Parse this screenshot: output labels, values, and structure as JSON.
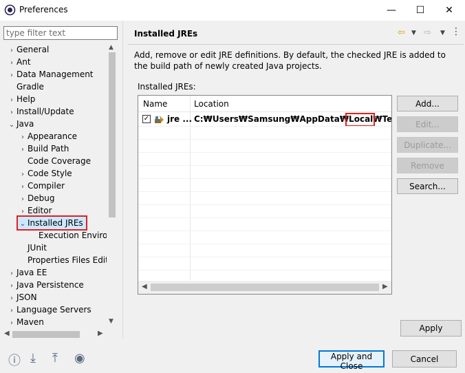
{
  "window": {
    "title": "Preferences",
    "controls": {
      "minimize": "—",
      "maximize": "☐",
      "close": "✕"
    }
  },
  "filter": {
    "placeholder": "type filter text",
    "value": ""
  },
  "tree": [
    {
      "label": "General",
      "expander": "›",
      "level": 0
    },
    {
      "label": "Ant",
      "expander": "›",
      "level": 0
    },
    {
      "label": "Data Management",
      "expander": "›",
      "level": 0
    },
    {
      "label": "Gradle",
      "expander": "",
      "level": 0
    },
    {
      "label": "Help",
      "expander": "›",
      "level": 0
    },
    {
      "label": "Install/Update",
      "expander": "›",
      "level": 0
    },
    {
      "label": "Java",
      "expander": "⌄",
      "level": 0
    },
    {
      "label": "Appearance",
      "expander": "›",
      "level": 1
    },
    {
      "label": "Build Path",
      "expander": "›",
      "level": 1
    },
    {
      "label": "Code Coverage",
      "expander": "",
      "level": 1
    },
    {
      "label": "Code Style",
      "expander": "›",
      "level": 1
    },
    {
      "label": "Compiler",
      "expander": "›",
      "level": 1
    },
    {
      "label": "Debug",
      "expander": "›",
      "level": 1
    },
    {
      "label": "Editor",
      "expander": "›",
      "level": 1
    },
    {
      "label": "Installed JREs",
      "expander": "⌄",
      "level": 1,
      "selected": true
    },
    {
      "label": "Execution Environ",
      "expander": "",
      "level": 2
    },
    {
      "label": "JUnit",
      "expander": "",
      "level": 1
    },
    {
      "label": "Properties Files Edito",
      "expander": "",
      "level": 1
    },
    {
      "label": "Java EE",
      "expander": "›",
      "level": 0
    },
    {
      "label": "Java Persistence",
      "expander": "›",
      "level": 0
    },
    {
      "label": "JSON",
      "expander": "›",
      "level": 0
    },
    {
      "label": "Language Servers",
      "expander": "›",
      "level": 0
    },
    {
      "label": "Maven",
      "expander": "›",
      "level": 0
    }
  ],
  "page": {
    "title": "Installed JREs",
    "description": "Add, remove or edit JRE definitions. By default, the checked JRE is added to the build path of newly created Java projects.",
    "list_label": "Installed JREs:",
    "columns": [
      "Name",
      "Location"
    ],
    "rows": [
      {
        "checked": true,
        "check_glyph": "✓",
        "name": "jre ...",
        "location": "C:₩Users₩Samsung₩AppData₩Local₩Temp₩eoiP"
      }
    ]
  },
  "buttons": {
    "add": "Add...",
    "edit": "Edit...",
    "duplicate": "Duplicate...",
    "remove": "Remove",
    "search": "Search...",
    "apply": "Apply",
    "apply_close": "Apply and Close",
    "cancel": "Cancel"
  },
  "colors": {
    "highlight": "#e0201f",
    "accent": "#0078d7"
  }
}
